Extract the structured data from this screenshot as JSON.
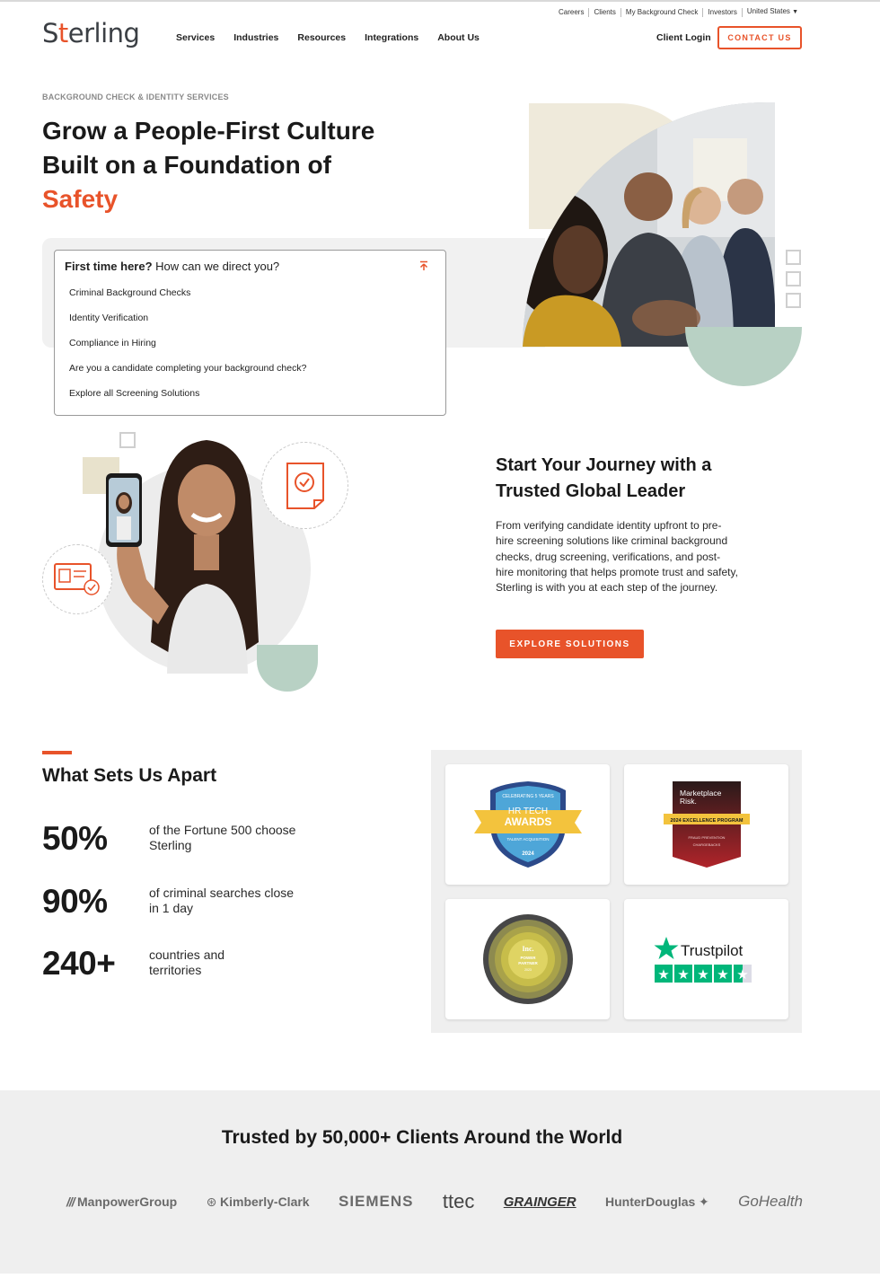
{
  "utility_nav": {
    "items": [
      "Careers",
      "Clients",
      "My Background Check",
      "Investors",
      "United States"
    ]
  },
  "brand": {
    "logo_text_a": "S",
    "logo_text_dot": "t",
    "logo_text_b": "erling"
  },
  "main_nav": {
    "items": [
      "Services",
      "Industries",
      "Resources",
      "Integrations",
      "About Us"
    ],
    "client_login": "Client Login",
    "contact": "CONTACT US"
  },
  "hero": {
    "eyebrow": "BACKGROUND CHECK & IDENTITY SERVICES",
    "title_line1": "Grow a People-First Culture",
    "title_line2": "Built on a Foundation of",
    "title_accent": "Safety"
  },
  "direct": {
    "lead": "First time here?",
    "question": " How can we direct you?",
    "options": [
      "Criminal Background Checks",
      "Identity Verification",
      "Compliance in Hiring",
      "Are you a candidate completing your background check?",
      "Explore all Screening Solutions"
    ]
  },
  "journey": {
    "title": "Start Your Journey with a Trusted Global Leader",
    "body": "From verifying candidate identity upfront to pre-hire screening solutions like criminal background checks, drug screening, verifications, and post-hire monitoring that helps promote trust and safety, Sterling is with you at each step of the journey.",
    "cta": "EXPLORE SOLUTIONS"
  },
  "apart": {
    "title": "What Sets Us Apart",
    "stats": [
      {
        "value": "50%",
        "label": "of the Fortune 500 choose Sterling"
      },
      {
        "value": "90%",
        "label": "of criminal searches close in 1 day"
      },
      {
        "value": "240+",
        "label": "countries and territories"
      }
    ]
  },
  "awards": {
    "hr_tech": {
      "top": "CELEBRATING 5 YEARS",
      "line1": "HR TECH",
      "line2": "AWARDS",
      "sub": "TALENT ACQUISITION",
      "year": "2024"
    },
    "marketplace": {
      "line1": "Marketplace",
      "line2": "Risk.",
      "ribbon": "2024 EXCELLENCE PROGRAM",
      "sub1": "FRAUD PREVENTION",
      "sub2": "CHARGEBACKS"
    },
    "inc": {
      "brand": "Inc.",
      "line1": "POWER",
      "line2": "PARTNER",
      "year": "2023"
    },
    "trustpilot": {
      "name": "Trustpilot"
    }
  },
  "trusted": {
    "title": "Trusted by 50,000+ Clients Around the World",
    "logos": [
      "ManpowerGroup",
      "Kimberly-Clark",
      "SIEMENS",
      "ttec",
      "GRAINGER",
      "HunterDouglas",
      "GoHealth"
    ]
  },
  "colors": {
    "accent": "#e8532a",
    "mint": "#b8d1c4",
    "cream": "#efeadb",
    "panel": "#efefef"
  }
}
